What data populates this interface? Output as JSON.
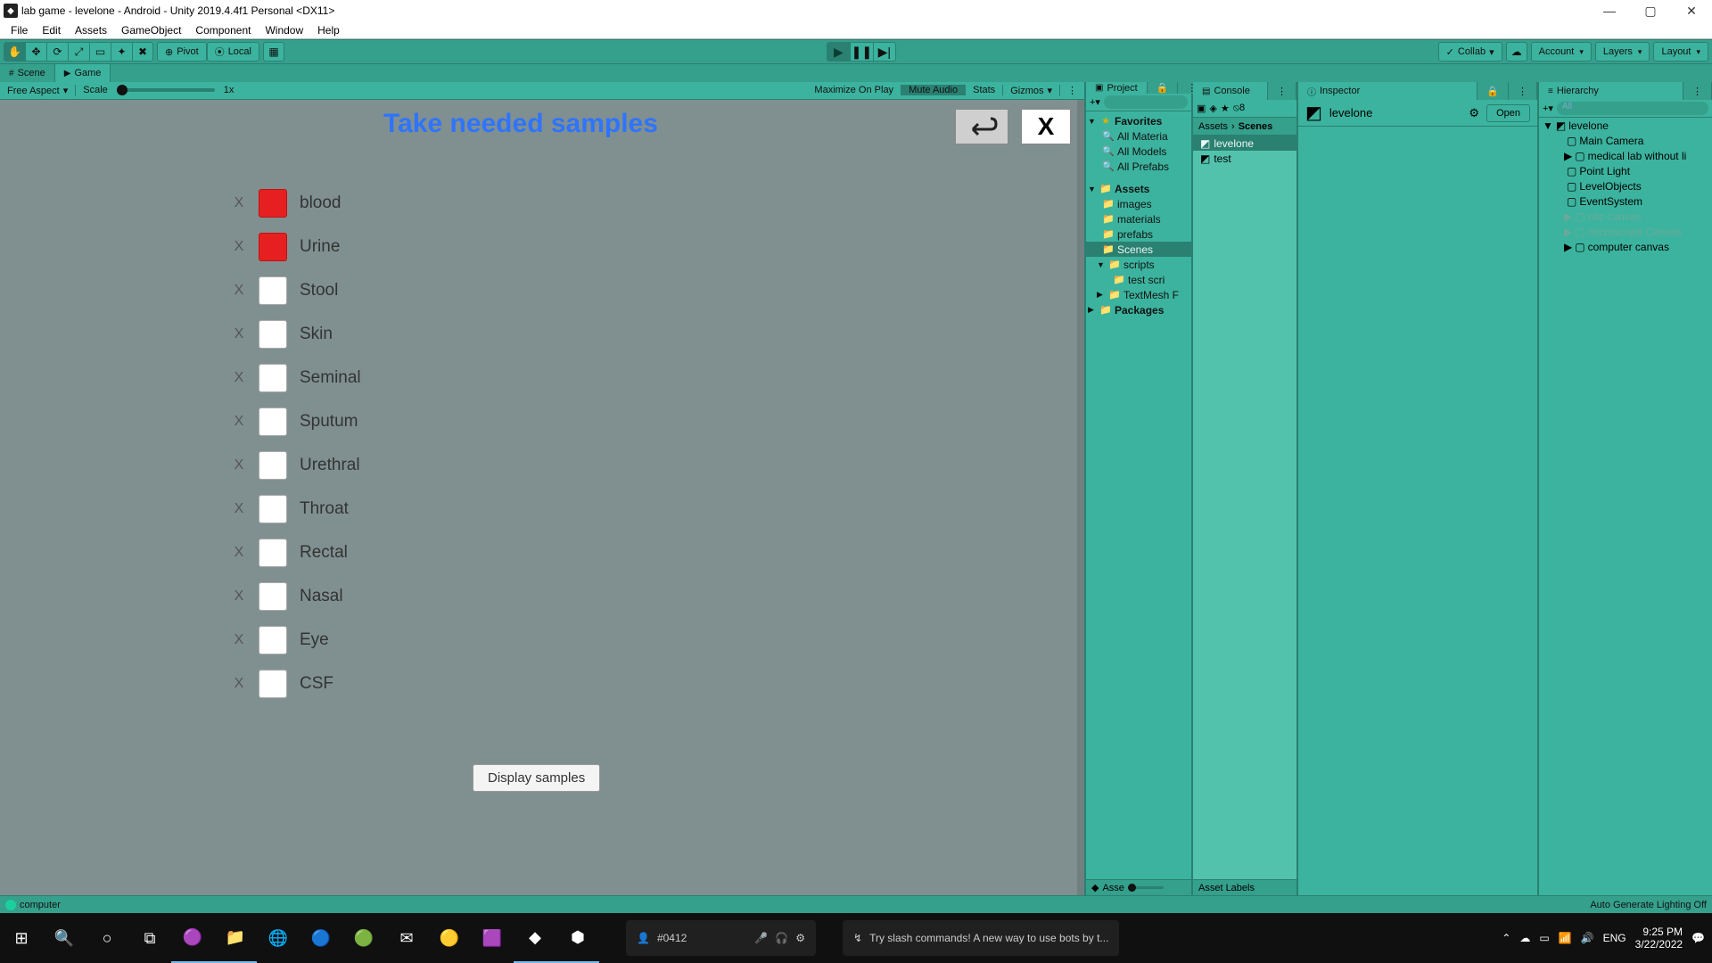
{
  "window": {
    "title": "lab game - levelone - Android - Unity 2019.4.4f1 Personal <DX11>"
  },
  "menu": [
    "File",
    "Edit",
    "Assets",
    "GameObject",
    "Component",
    "Window",
    "Help"
  ],
  "toolbar": {
    "pivot": "Pivot",
    "local": "Local",
    "collab": "Collab",
    "account": "Account",
    "layers": "Layers",
    "layout": "Layout"
  },
  "tabs": {
    "scene": "Scene",
    "game": "Game",
    "project": "Project",
    "console": "Console",
    "inspector": "Inspector",
    "hierarchy": "Hierarchy"
  },
  "gameToolbar": {
    "aspect": "Free Aspect",
    "scale": "Scale",
    "scaleVal": "1x",
    "maxOnPlay": "Maximize On Play",
    "muteAudio": "Mute Audio",
    "stats": "Stats",
    "gizmos": "Gizmos"
  },
  "game": {
    "title": "Take needed samples",
    "displayBtn": "Display samples",
    "samples": [
      {
        "label": "blood",
        "checked": true
      },
      {
        "label": "Urine",
        "checked": true
      },
      {
        "label": "Stool",
        "checked": false
      },
      {
        "label": "Skin",
        "checked": false
      },
      {
        "label": "Seminal",
        "checked": false
      },
      {
        "label": "Sputum",
        "checked": false
      },
      {
        "label": "Urethral",
        "checked": false
      },
      {
        "label": "Throat",
        "checked": false
      },
      {
        "label": "Rectal",
        "checked": false
      },
      {
        "label": "Nasal",
        "checked": false
      },
      {
        "label": "Eye",
        "checked": false
      },
      {
        "label": "CSF",
        "checked": false
      }
    ]
  },
  "project": {
    "favorites": "Favorites",
    "allMat": "All Materia",
    "allMod": "All Models",
    "allPre": "All Prefabs",
    "assets": "Assets",
    "images": "images",
    "materials": "materials",
    "prefabs": "prefabs",
    "scenes": "Scenes",
    "scripts": "scripts",
    "testscr": "test scri",
    "textmesh": "TextMesh F",
    "packages": "Packages",
    "iconCount": "8",
    "footer": "Asse"
  },
  "assets": {
    "crumb1": "Assets",
    "crumb2": "Scenes",
    "items": [
      {
        "name": "levelone",
        "selected": true
      },
      {
        "name": "test",
        "selected": false
      }
    ],
    "footer": "Asset Labels"
  },
  "inspector": {
    "name": "levelone",
    "open": "Open"
  },
  "hierarchy": {
    "search": "All",
    "root": "levelone",
    "items": [
      {
        "name": "Main Camera",
        "muted": false,
        "indent": 2
      },
      {
        "name": "medical lab without li",
        "muted": false,
        "indent": 2,
        "arrow": true
      },
      {
        "name": "Point Light",
        "muted": false,
        "indent": 2
      },
      {
        "name": "LevelObjects",
        "muted": false,
        "indent": 2
      },
      {
        "name": "EventSystem",
        "muted": false,
        "indent": 2
      },
      {
        "name": "cbc canvas",
        "muted": true,
        "indent": 2,
        "arrow": true
      },
      {
        "name": "microscope Canvas",
        "muted": true,
        "indent": 2,
        "arrow": true
      },
      {
        "name": "computer canvas",
        "muted": false,
        "indent": 2,
        "arrow": true
      }
    ]
  },
  "status": {
    "msg": "computer",
    "lighting": "Auto Generate Lighting Off"
  },
  "chat": {
    "cmd": "#0412",
    "tip": "Try slash commands! A new way to use bots by t..."
  },
  "tray": {
    "lang": "ENG",
    "time": "9:25 PM",
    "date": "3/22/2022"
  }
}
